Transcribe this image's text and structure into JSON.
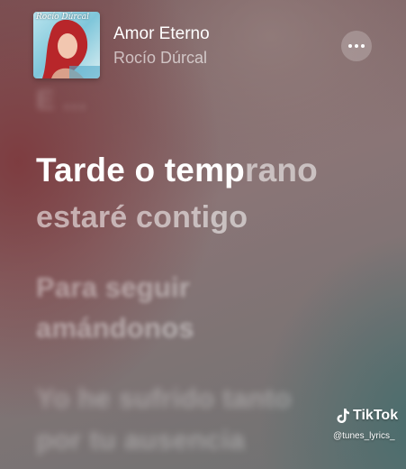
{
  "now_playing": {
    "album_cover_text": "Rocío Dúrcal",
    "title": "Amor Eterno",
    "artist": "Rocío Dúrcal",
    "more_icon": "ellipsis-icon"
  },
  "lyrics": {
    "previous": "E ...",
    "current_line_1_sung": "Tarde o temp",
    "current_line_1_unsung": "rano",
    "current_line_2": "estaré contigo",
    "next_1": "Para seguir",
    "next_2": "amándonos",
    "next_3": "Yo he sufrido tanto",
    "next_4": "por tu ausencia"
  },
  "watermark": {
    "brand": "TikTok",
    "handle": "@tunes_lyrics_",
    "icon": "tiktok-note-icon"
  }
}
